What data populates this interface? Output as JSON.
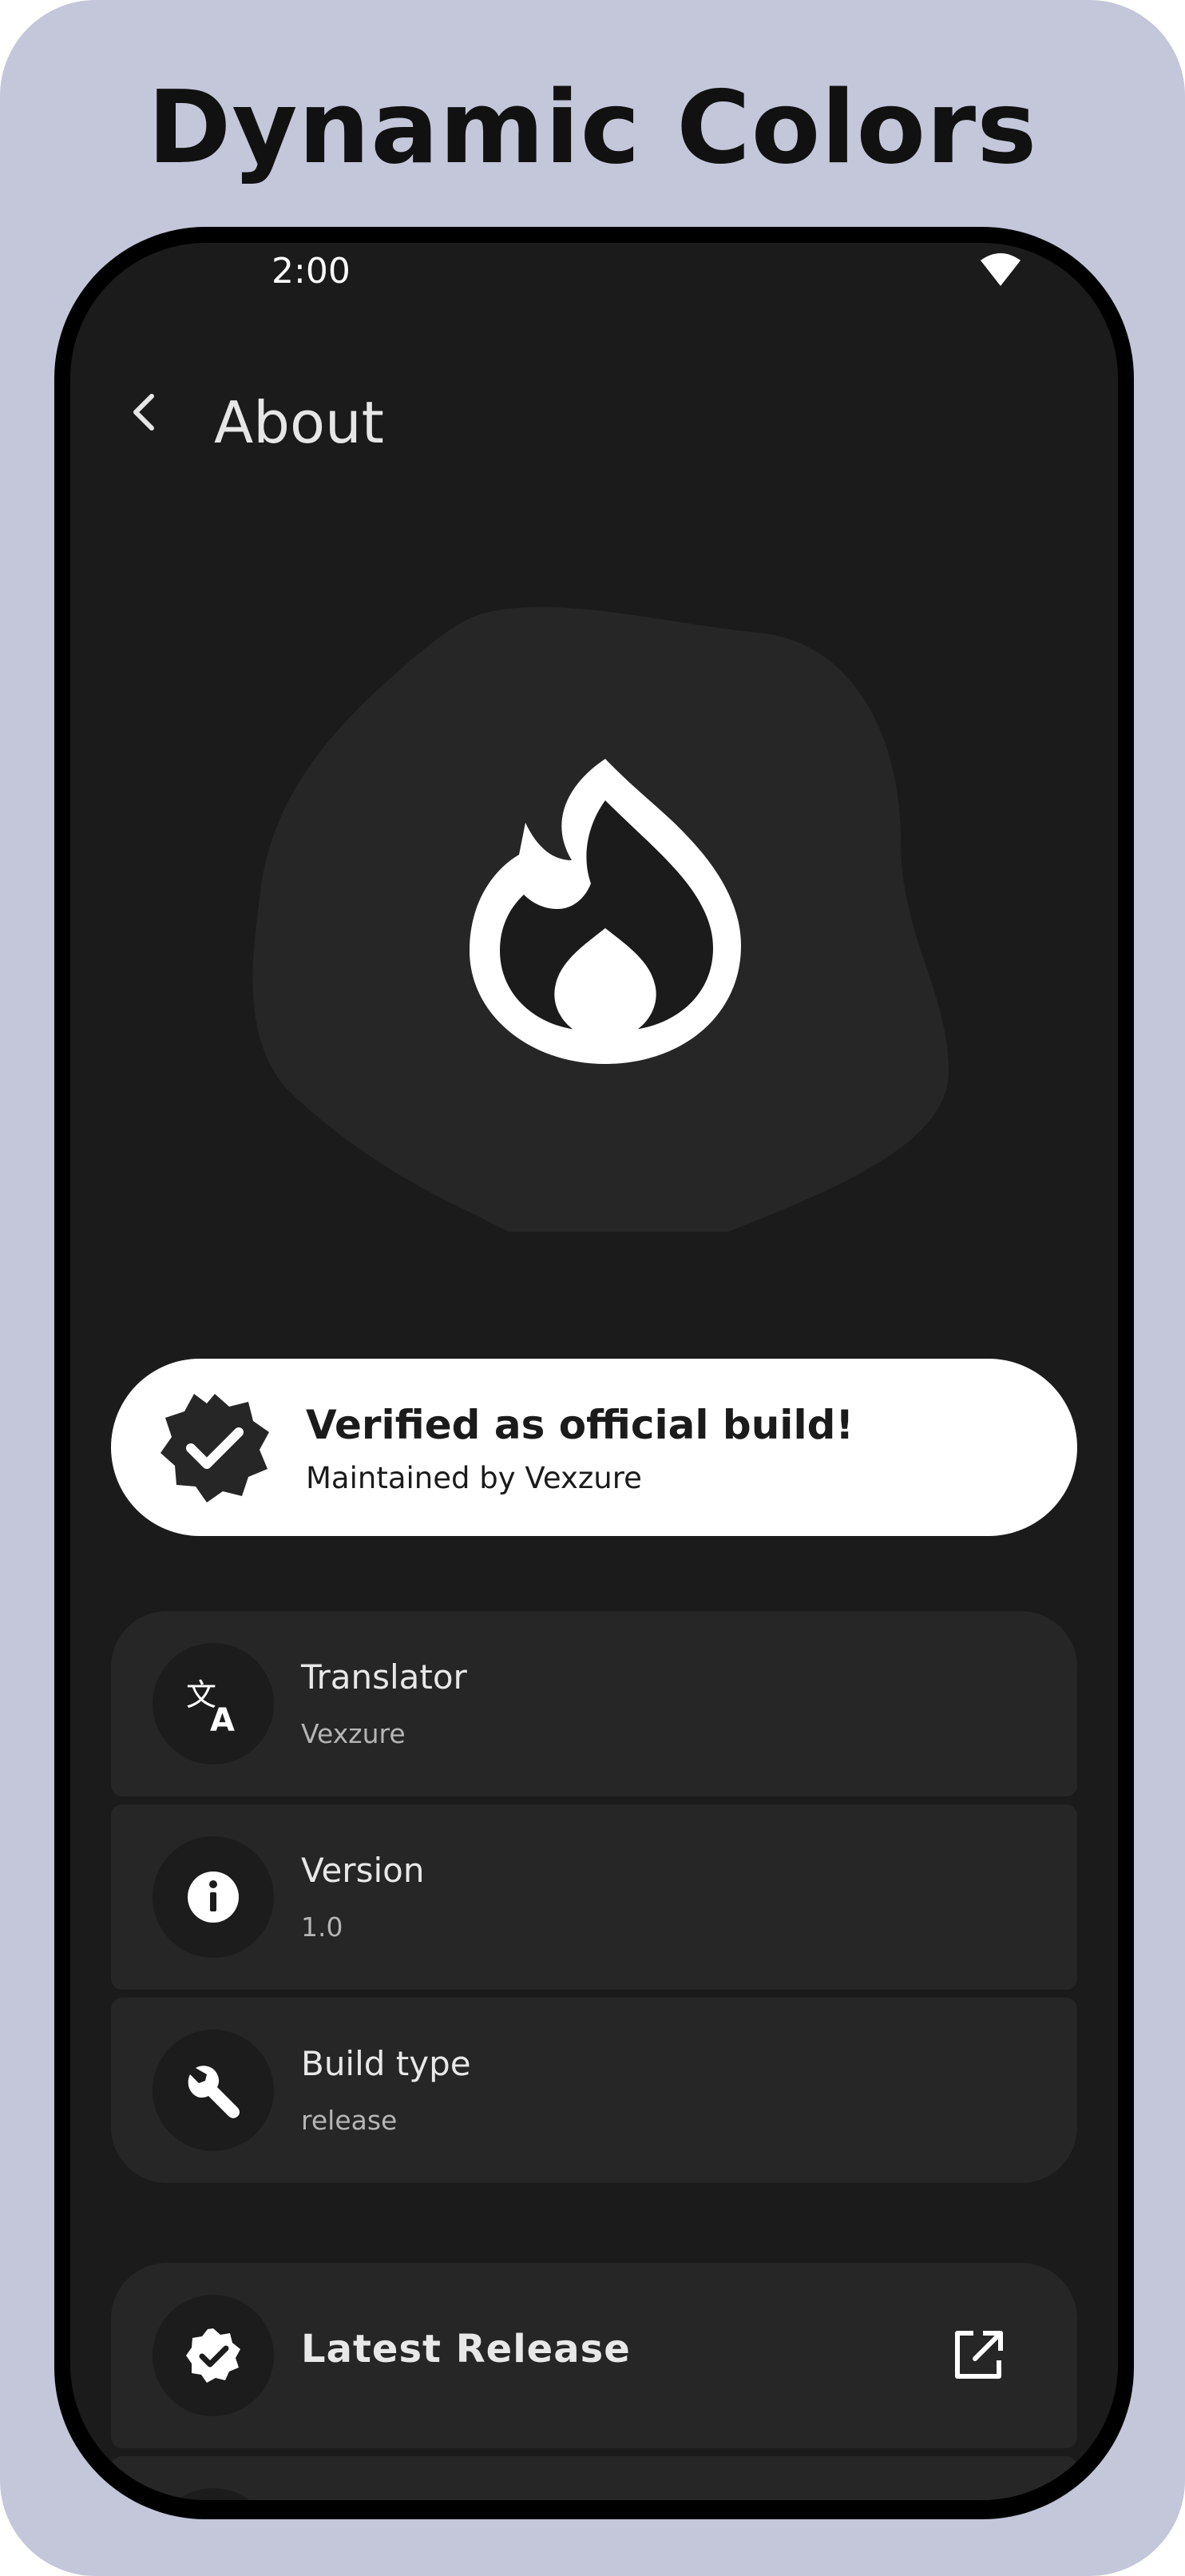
{
  "headline": "Dynamic Colors",
  "status_bar": {
    "time": "2:00",
    "wifi_icon": "wifi-icon"
  },
  "app_bar": {
    "back_icon": "back-arrow-icon",
    "title": "About"
  },
  "hero": {
    "icon": "flame-icon"
  },
  "verified": {
    "icon": "verified-badge-icon",
    "title": "Verified as official build!",
    "subtitle": "Maintained by Vexzure"
  },
  "info_items": [
    {
      "icon": "translate-icon",
      "title": "Translator",
      "value": "Vexzure"
    },
    {
      "icon": "info-icon",
      "title": "Version",
      "value": "1.0"
    },
    {
      "icon": "wrench-icon",
      "title": "Build type",
      "value": "release"
    }
  ],
  "links": [
    {
      "icon": "verified-icon",
      "label": "Latest Release",
      "trailing_icon": "open-external-icon"
    }
  ],
  "colors": {
    "frame_background": "#c4c6da",
    "screen_background": "#1b1b1b",
    "card_background": "#262626",
    "verified_card": "#ffffff"
  }
}
